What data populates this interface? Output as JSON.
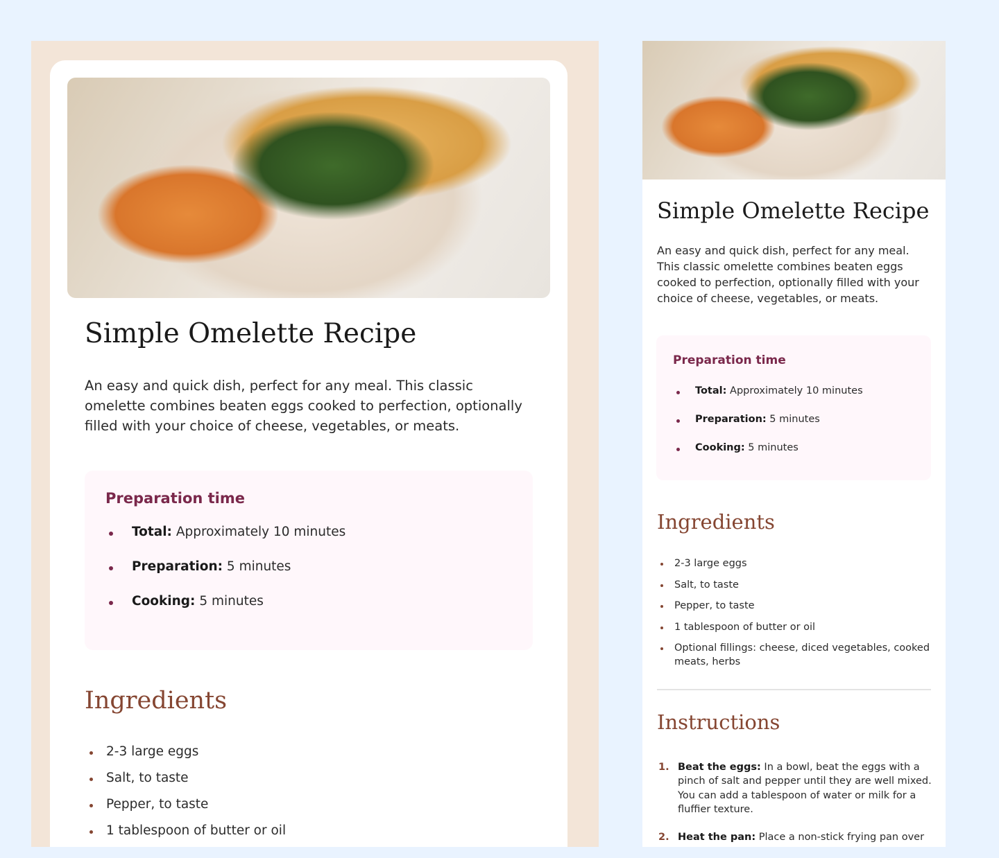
{
  "recipe": {
    "title": "Simple Omelette Recipe",
    "description": "An easy and quick dish, perfect for any meal. This classic omelette combines beaten eggs cooked to perfection, optionally filled with your choice of cheese, vegetables, or meats.",
    "prep": {
      "heading": "Preparation time",
      "items": [
        {
          "label": "Total:",
          "value": " Approximately 10 minutes"
        },
        {
          "label": "Preparation:",
          "value": " 5 minutes"
        },
        {
          "label": "Cooking:",
          "value": " 5 minutes"
        }
      ]
    },
    "ingredients": {
      "heading": "Ingredients",
      "items": [
        "2-3 large eggs",
        "Salt, to taste",
        "Pepper, to taste",
        "1 tablespoon of butter or oil",
        "Optional fillings: cheese, diced vegetables, cooked meats, herbs"
      ]
    },
    "instructions": {
      "heading": "Instructions",
      "items": [
        {
          "num": "1.",
          "label": "Beat the eggs:",
          "value": " In a bowl, beat the eggs with a pinch of salt and pepper until they are well mixed. You can add a tablespoon of water or milk for a fluffier texture."
        },
        {
          "num": "2.",
          "label": "Heat the pan:",
          "value": " Place a non-stick frying pan over"
        }
      ]
    }
  },
  "colors": {
    "page_bg": "#e9f3ff",
    "desktop_bg": "#f3e5d8",
    "accent_rose": "#7a284b",
    "accent_brown": "#854632",
    "prep_bg": "#fff7fb"
  }
}
